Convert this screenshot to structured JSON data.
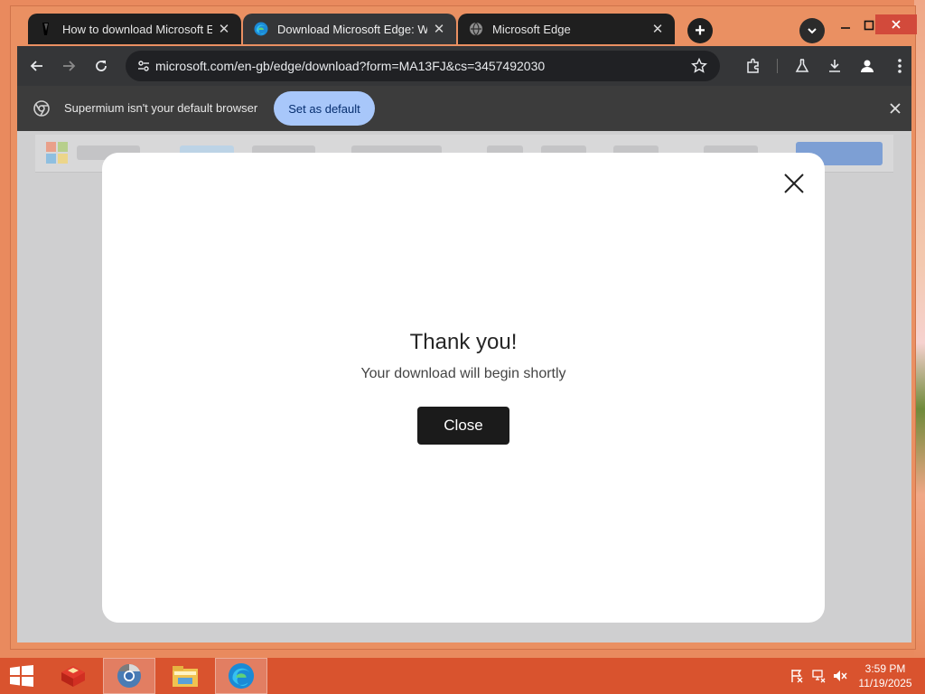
{
  "browser": {
    "tabs": [
      {
        "title": "How to download Microsoft Edg",
        "active": false
      },
      {
        "title": "Download Microsoft Edge: Wind",
        "active": true
      },
      {
        "title": "Microsoft Edge",
        "active": false
      }
    ],
    "tab_close_glyph": "✕",
    "new_tab_glyph": "+",
    "address": "microsoft.com/en-gb/edge/download?form=MA13FJ&cs=3457492030",
    "infobar": {
      "message": "Supermium isn't your default browser",
      "button": "Set as default"
    }
  },
  "dialog": {
    "title": "Thank you!",
    "subtitle": "Your download will begin shortly",
    "button": "Close"
  },
  "taskbar": {
    "time": "3:59 PM",
    "date": "11/19/2025"
  },
  "colors": {
    "accent_blue": "#a8c7fa",
    "taskbar": "#d9532e",
    "window_frame": "#ea9062"
  }
}
